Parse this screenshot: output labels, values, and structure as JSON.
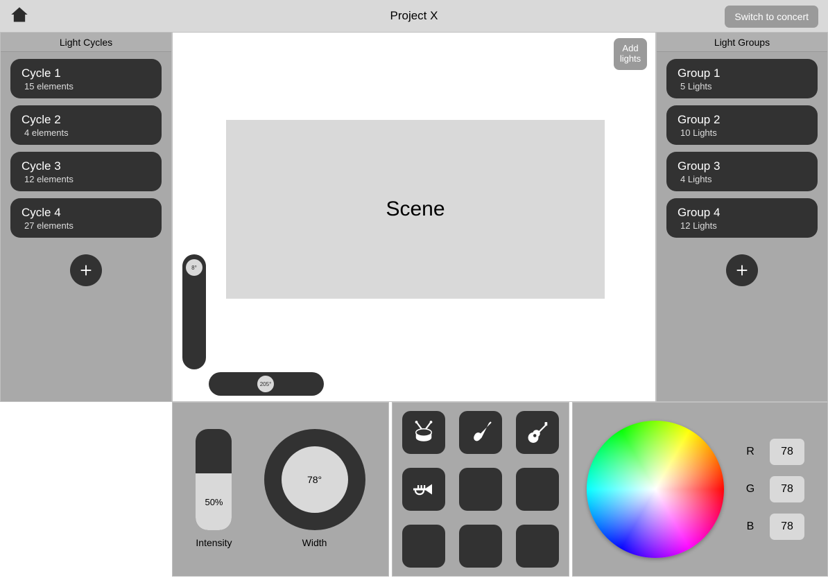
{
  "header": {
    "title": "Project X",
    "switch_label": "Switch to concert"
  },
  "cycles": {
    "title": "Light Cycles",
    "items": [
      {
        "name": "Cycle 1",
        "sub": "15 elements"
      },
      {
        "name": "Cycle 2",
        "sub": " 4 elements"
      },
      {
        "name": "Cycle 3",
        "sub": "12 elements"
      },
      {
        "name": "Cycle 4",
        "sub": "27 elements"
      }
    ]
  },
  "groups": {
    "title": "Light Groups",
    "items": [
      {
        "name": "Group 1",
        "sub": " 5 Lights"
      },
      {
        "name": "Group 2",
        "sub": " 10 Lights"
      },
      {
        "name": "Group 3",
        "sub": " 4 Lights"
      },
      {
        "name": "Group 4",
        "sub": " 12 Lights"
      }
    ]
  },
  "canvas": {
    "add_lights_label": "Add lights",
    "scene_label": "Scene",
    "v_slider_value": "8°",
    "h_slider_value": "205°"
  },
  "intensity": {
    "value": "50%",
    "label": "Intensity"
  },
  "width": {
    "value": "78°",
    "label": "Width"
  },
  "instruments": {
    "icons": [
      "drum-icon",
      "electric-guitar-icon",
      "acoustic-guitar-icon",
      "trumpet-icon",
      "",
      "",
      "",
      "",
      ""
    ]
  },
  "color": {
    "r_label": "R",
    "g_label": "G",
    "b_label": "B",
    "r": "78",
    "g": "78",
    "b": "78"
  }
}
